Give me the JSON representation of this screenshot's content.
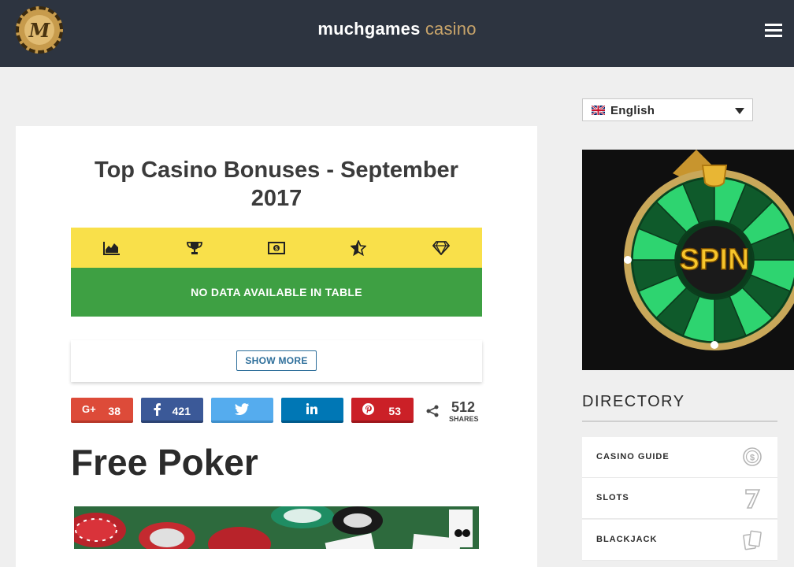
{
  "header": {
    "brand_main": "muchgames",
    "brand_accent": "casino",
    "logo_letter": "M"
  },
  "main": {
    "title": "Top Casino Bonuses - September 2017",
    "table_icons": [
      "chart-area-icon",
      "trophy-icon",
      "money-icon",
      "star-half-icon",
      "diamond-icon"
    ],
    "no_data": "NO DATA AVAILABLE IN TABLE",
    "show_more": "SHOW MORE",
    "share": {
      "google_count": "38",
      "facebook_count": "421",
      "pinterest_count": "53",
      "total": "512",
      "total_label": "SHARES"
    },
    "section_heading": "Free Poker"
  },
  "sidebar": {
    "language": "English",
    "spin_text": "SPIN",
    "directory_title": "DIRECTORY",
    "directory": [
      {
        "label": "CASINO GUIDE",
        "icon": "dollar-coin-icon"
      },
      {
        "label": "SLOTS",
        "icon": "seven-icon"
      },
      {
        "label": "BLACKJACK",
        "icon": "cards-icon"
      }
    ]
  },
  "colors": {
    "header_bg": "#2d3440",
    "accent_gold": "#c8a46a",
    "yellow_bar": "#f9e04a",
    "green_bar": "#3ea043",
    "link_blue": "#2d6e9a"
  }
}
